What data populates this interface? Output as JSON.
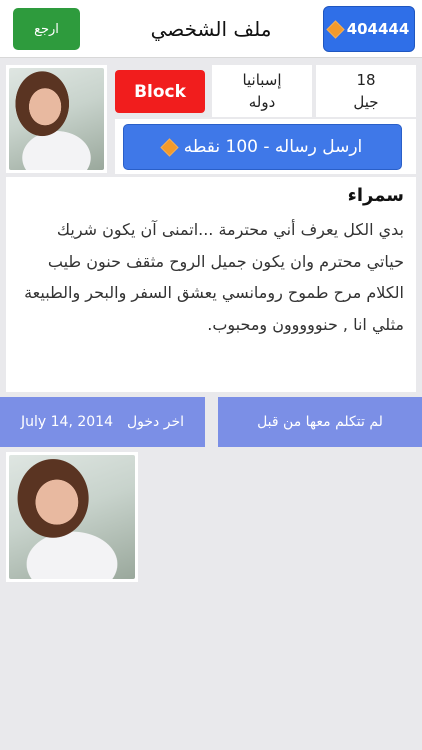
{
  "header": {
    "title": "ملف الشخصي",
    "points_value": "404444",
    "back_label": "ارجع"
  },
  "profile": {
    "block_label": "Block",
    "country_value": "إسبانيا",
    "country_label": "دوله",
    "age_value": "18",
    "age_label": "جيل",
    "send_message_label": "ارسل رساله - 100 نقطه"
  },
  "about": {
    "name": "سمراء",
    "text": "بدي الكل يعرف أني محترمة ...اتمنى آن يكون شريك حياتي محترم وان يكون جميل الروح مثقف حنون طيب الكلام مرح طموح رومانسي يعشق السفر والبحر والطبيعة مثلي انا , حنووووون ومحبوب."
  },
  "status": {
    "chat_status": "لم تتكلم معها من قبل",
    "last_login_label": "اخر دخول",
    "last_login_date": "July 14, 2014"
  },
  "colors": {
    "points_button": "#2f6fe8",
    "back_button": "#2e9b3d",
    "block_button": "#f11d1d",
    "send_button": "#3f78e8",
    "status_bar": "#7b8fe6",
    "diamond": "#f39a2b"
  },
  "icons": {
    "points": "diamond-icon",
    "send": "diamond-icon"
  }
}
